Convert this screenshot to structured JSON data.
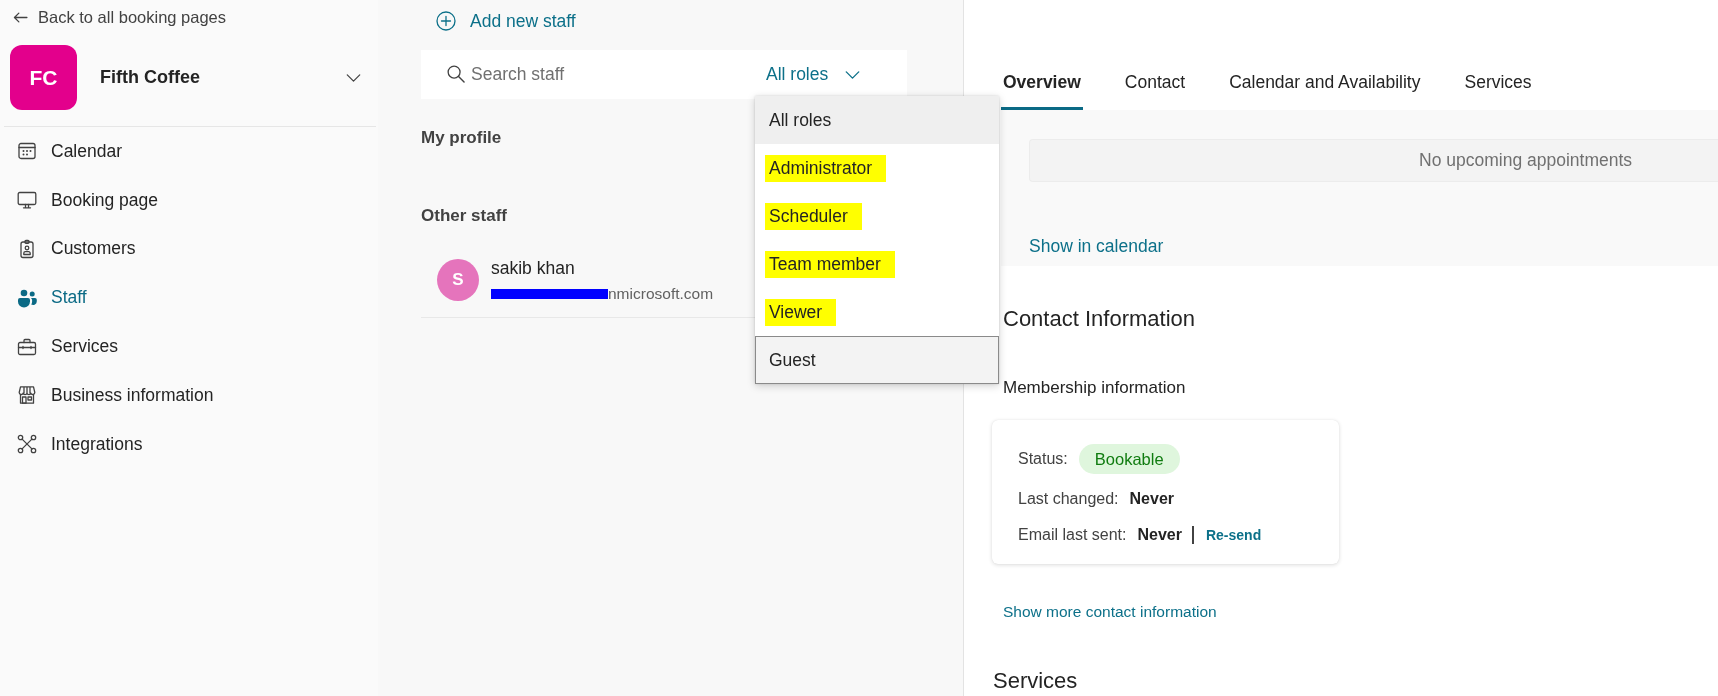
{
  "sidebar": {
    "back_link": "Back to all booking pages",
    "business": {
      "initials": "FC",
      "name": "Fifth Coffee"
    },
    "items": [
      {
        "label": "Calendar",
        "selected": false
      },
      {
        "label": "Booking page",
        "selected": false
      },
      {
        "label": "Customers",
        "selected": false
      },
      {
        "label": "Staff",
        "selected": true
      },
      {
        "label": "Services",
        "selected": false
      },
      {
        "label": "Business information",
        "selected": false
      },
      {
        "label": "Integrations",
        "selected": false
      }
    ]
  },
  "staff_panel": {
    "add_button": "Add new staff",
    "search": {
      "placeholder": "Search staff"
    },
    "role_filter": {
      "value": "All roles",
      "expanded": true,
      "options": [
        {
          "label": "All roles",
          "selected": true,
          "focused": false,
          "highlighted": false
        },
        {
          "label": "Administrator",
          "selected": false,
          "focused": false,
          "highlighted": true
        },
        {
          "label": "Scheduler",
          "selected": false,
          "focused": false,
          "highlighted": true
        },
        {
          "label": "Team member",
          "selected": false,
          "focused": false,
          "highlighted": true
        },
        {
          "label": "Viewer",
          "selected": false,
          "focused": false,
          "highlighted": true
        },
        {
          "label": "Guest",
          "selected": false,
          "focused": true,
          "highlighted": false
        }
      ]
    },
    "my_profile_heading": "My profile",
    "other_staff": {
      "heading": "Other staff",
      "members": [
        {
          "initial": "S",
          "name": "sakib khan",
          "email": "nmicrosoft.com",
          "redacted": true
        }
      ]
    }
  },
  "detail_panel": {
    "tabs": [
      {
        "label": "Overview",
        "selected": true
      },
      {
        "label": "Contact",
        "selected": false
      },
      {
        "label": "Calendar and Availability",
        "selected": false
      },
      {
        "label": "Services",
        "selected": false
      }
    ],
    "overview": {
      "appointments_message": "No upcoming appointments",
      "calendar_link": "Show in calendar",
      "contact": {
        "title": "Contact Information",
        "membership_title": "Membership information",
        "status_label": "Status:",
        "status": "Bookable",
        "last_changed_label": "Last changed:",
        "last_changed": "Never",
        "email_sent_label": "Email last sent:",
        "email_sent": "Never",
        "resend_link": "Re-send",
        "more_link": "Show more contact information"
      },
      "services_title": "Services"
    }
  }
}
